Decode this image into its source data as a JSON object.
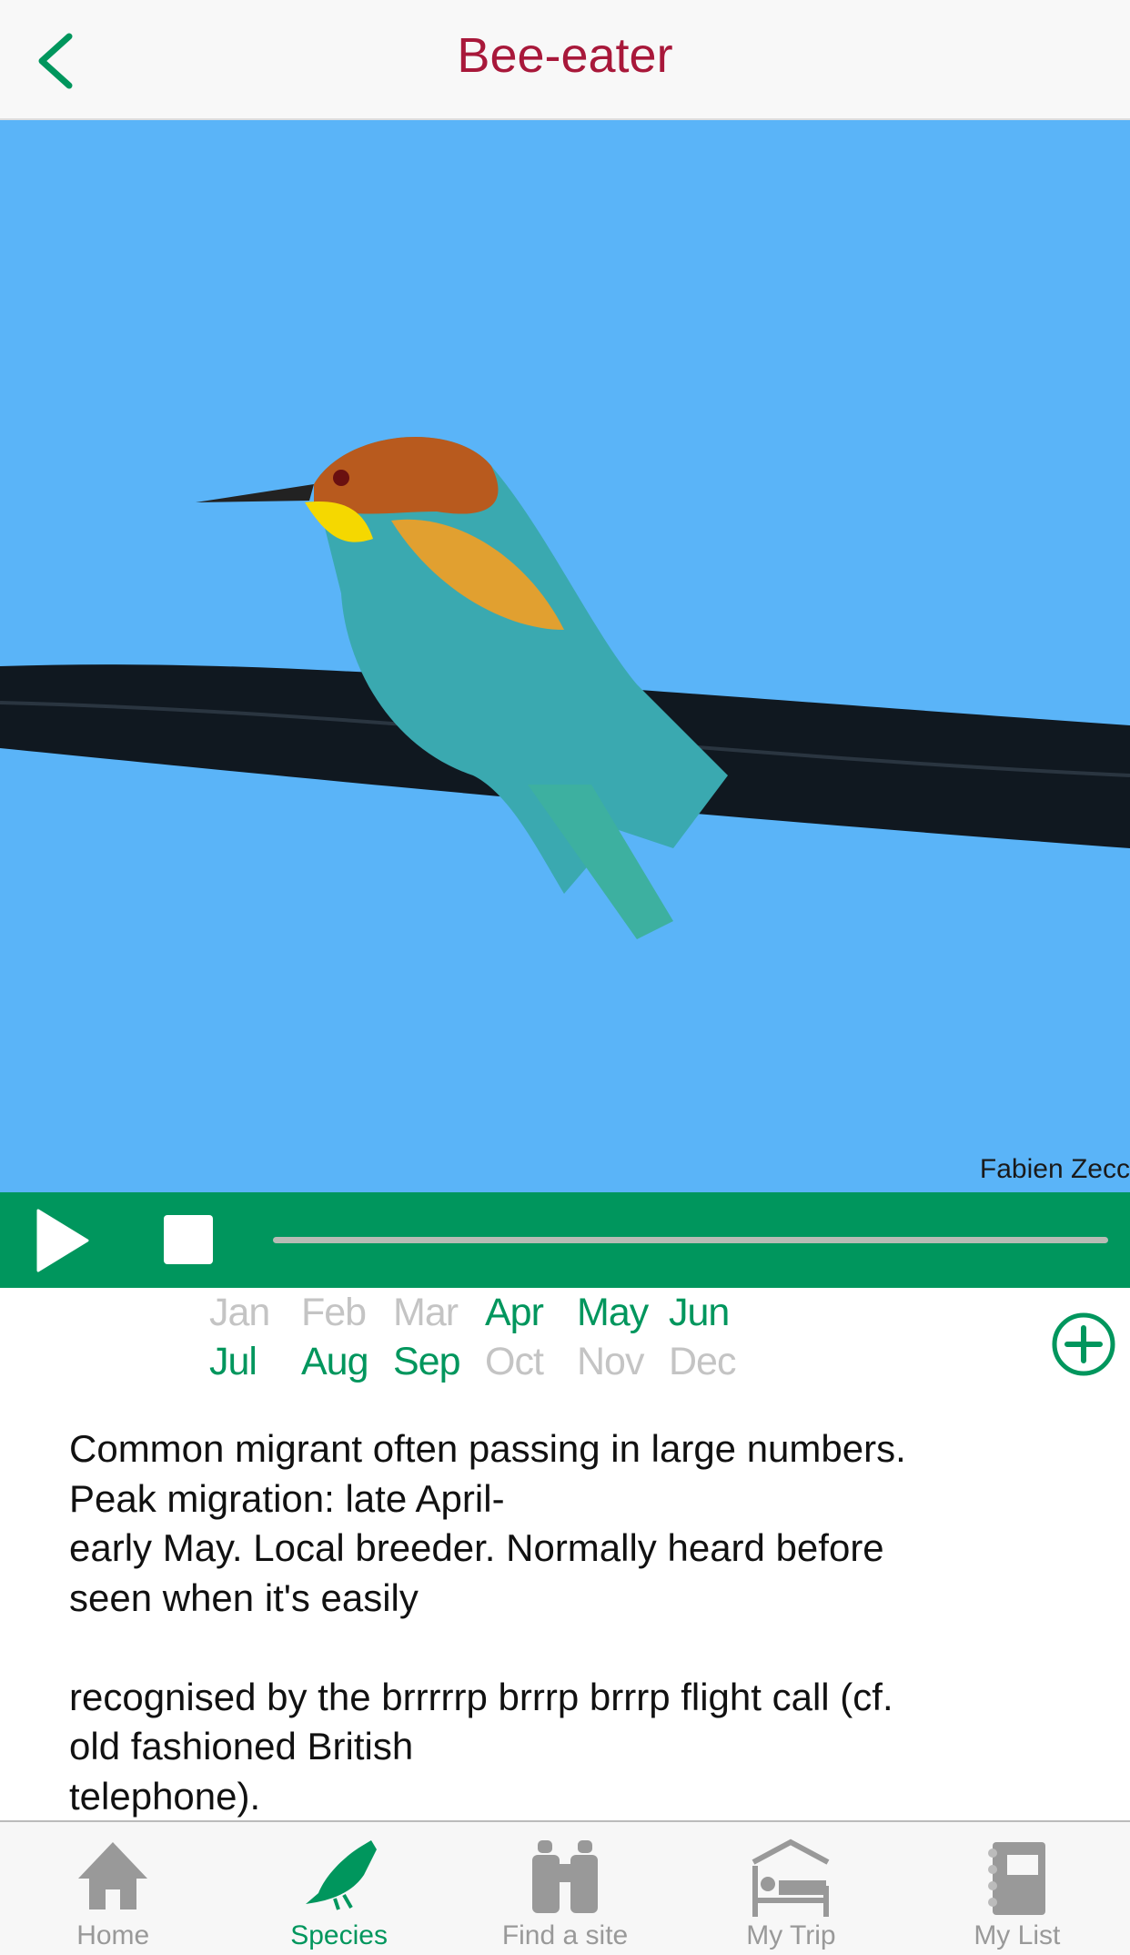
{
  "header": {
    "title": "Bee-eater",
    "back_icon": "chevron-left-icon"
  },
  "photo": {
    "credit": "Fabien Zecc"
  },
  "player": {
    "play_icon": "play-icon",
    "stop_icon": "stop-icon",
    "progress": 0
  },
  "months": {
    "items": [
      {
        "label": "Jan",
        "active": false
      },
      {
        "label": "Feb",
        "active": false
      },
      {
        "label": "Mar",
        "active": false
      },
      {
        "label": "Apr",
        "active": true
      },
      {
        "label": "May",
        "active": true
      },
      {
        "label": "Jun",
        "active": true
      },
      {
        "label": "Jul",
        "active": true
      },
      {
        "label": "Aug",
        "active": true
      },
      {
        "label": "Sep",
        "active": true
      },
      {
        "label": "Oct",
        "active": false
      },
      {
        "label": "Nov",
        "active": false
      },
      {
        "label": "Dec",
        "active": false
      }
    ],
    "add_icon": "plus-circle-icon"
  },
  "description": "Common migrant often passing in large numbers.\nPeak migration: late April-\nearly May. Local breeder. Normally heard before\nseen when it's easily\n\nrecognised by the brrrrrp brrrp brrrp flight call (cf.\nold fashioned British\ntelephone).",
  "nav": {
    "items": [
      {
        "label": "Home",
        "icon": "home-icon",
        "active": false
      },
      {
        "label": "Species",
        "icon": "bird-icon",
        "active": true
      },
      {
        "label": "Find a site",
        "icon": "binoculars-icon",
        "active": false
      },
      {
        "label": "My Trip",
        "icon": "bed-icon",
        "active": false
      },
      {
        "label": "My List",
        "icon": "notebook-icon",
        "active": false
      }
    ]
  },
  "colors": {
    "accent": "#00965d",
    "title": "#a8183a",
    "sky": "#5ab4f8"
  }
}
